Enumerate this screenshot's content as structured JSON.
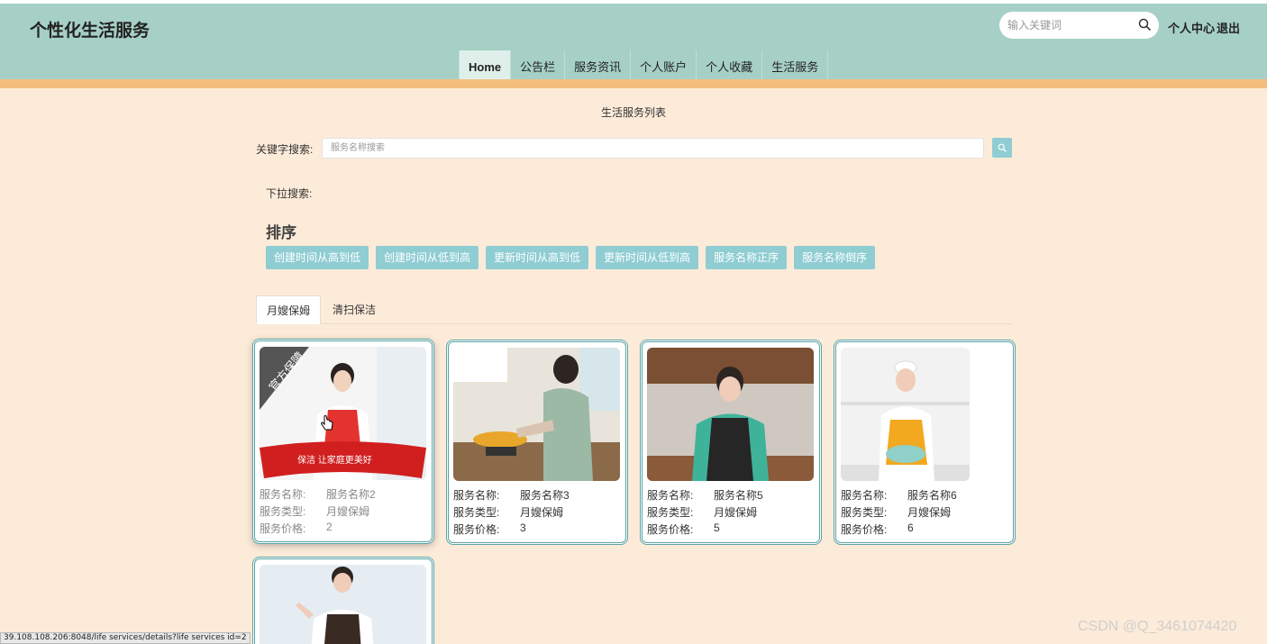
{
  "header": {
    "brand": "个性化生活服务",
    "search_placeholder": "输入关键词",
    "user_center": "个人中心",
    "logout": "退出"
  },
  "nav": [
    "Home",
    "公告栏",
    "服务资讯",
    "个人账户",
    "个人收藏",
    "生活服务"
  ],
  "page_title": "生活服务列表",
  "search": {
    "label": "关键字搜索:",
    "placeholder": "服务名称搜索"
  },
  "dropdown_label": "下拉搜索:",
  "sort": {
    "title": "排序",
    "buttons": [
      "创建时间从高到低",
      "创建时间从低到高",
      "更新时间从高到低",
      "更新时间从低到高",
      "服务名称正序",
      "服务名称倒序"
    ]
  },
  "tabs": [
    "月嫂保姆",
    "清扫保洁"
  ],
  "field_labels": {
    "name": "服务名称:",
    "type": "服务类型:",
    "price": "服务价格:"
  },
  "cards": [
    {
      "name": "服务名称2",
      "type": "月嫂保姆",
      "price": "2",
      "banner": "官方保障",
      "ribbon": "保洁 让家庭更美好"
    },
    {
      "name": "服务名称3",
      "type": "月嫂保姆",
      "price": "3"
    },
    {
      "name": "服务名称5",
      "type": "月嫂保姆",
      "price": "5"
    },
    {
      "name": "服务名称6",
      "type": "月嫂保姆",
      "price": "6"
    },
    {}
  ],
  "status_url": "39.108.108.206:8048/life services/details?life services id=2",
  "watermark": "CSDN @Q_3461074420",
  "colors": {
    "header": "#a6d0c5",
    "accent_strip": "#f4bf7c",
    "background": "#fdebd9",
    "button": "#8fcdd3",
    "card_border": "#5aa3a5"
  }
}
